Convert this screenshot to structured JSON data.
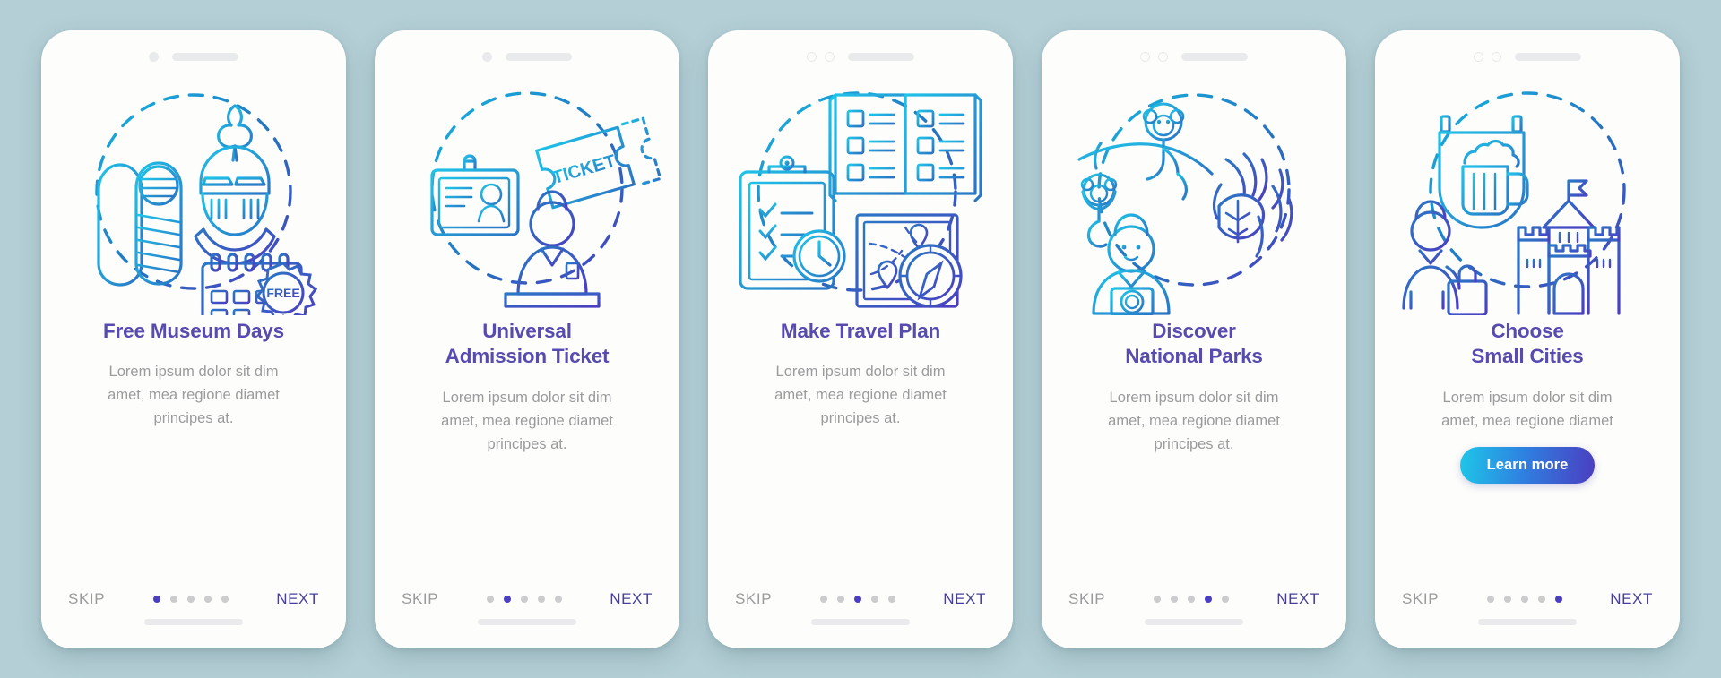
{
  "background_color": "#b4cfd6",
  "theme": {
    "title_color": "#574bb0",
    "desc_color": "#9b9b9e",
    "accent_color": "#4b3ec0",
    "button_gradient_from": "#1ec6e8",
    "button_gradient_to": "#4b3ec0",
    "card_background": "#fdfdfb"
  },
  "shared": {
    "skip_label": "SKIP",
    "next_label": "NEXT",
    "description": "Lorem ipsum dolor sit dim\namet, mea regione diamet\nprincipes at.",
    "description_short": "Lorem ipsum dolor sit dim\namet, mea regione diamet",
    "total_dots": 5
  },
  "screens": [
    {
      "id": "free-museum-days",
      "title": "Free Museum Days",
      "description": "Lorem ipsum dolor sit dim\namet, mea regione diamet\nprincipes at.",
      "skip_label": "SKIP",
      "next_label": "NEXT",
      "active_dot": 1,
      "illustration": "museum-knight-mummy-calendar-icon",
      "illustration_labels": [
        "FREE"
      ],
      "camera_style": "single-solid-dot",
      "button": null
    },
    {
      "id": "universal-admission-ticket",
      "title": "Universal\nAdmission Ticket",
      "description": "Lorem ipsum dolor sit dim\namet, mea regione diamet\nprincipes at.",
      "skip_label": "SKIP",
      "next_label": "NEXT",
      "active_dot": 2,
      "illustration": "ticket-badge-attendant-icon",
      "illustration_labels": [
        "TICKET"
      ],
      "camera_style": "single-solid-dot",
      "button": null
    },
    {
      "id": "make-travel-plan",
      "title": "Make Travel Plan",
      "description": "Lorem ipsum dolor sit dim\namet, mea regione diamet\nprincipes at.",
      "skip_label": "SKIP",
      "next_label": "NEXT",
      "active_dot": 3,
      "illustration": "clipboard-brochure-map-compass-icon",
      "illustration_labels": [],
      "camera_style": "double-ring-dot",
      "button": null
    },
    {
      "id": "discover-national-parks",
      "title": "Discover\nNational Parks",
      "description": "Lorem ipsum dolor sit dim\namet, mea regione diamet\nprincipes at.",
      "skip_label": "SKIP",
      "next_label": "NEXT",
      "active_dot": 4,
      "illustration": "monkey-photographer-jungle-icon",
      "illustration_labels": [],
      "camera_style": "double-ring-dot",
      "button": null
    },
    {
      "id": "choose-small-cities",
      "title": "Choose\nSmall Cities",
      "description": "Lorem ipsum dolor sit dim\namet, mea regione diamet",
      "skip_label": "SKIP",
      "next_label": "NEXT",
      "active_dot": 5,
      "illustration": "beer-sign-traveler-castle-icon",
      "illustration_labels": [],
      "camera_style": "double-ring-dot",
      "button": "Learn more"
    }
  ]
}
